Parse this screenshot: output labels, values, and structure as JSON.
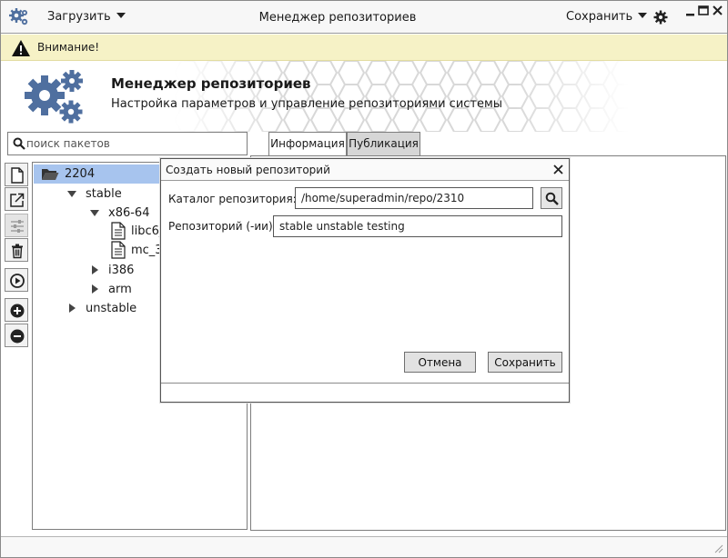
{
  "window": {
    "title": "Менеджер репозиториев",
    "menu_load": "Загрузить",
    "menu_save": "Сохранить"
  },
  "warning": {
    "text": "Внимание!"
  },
  "header": {
    "title": "Менеджер репозиториев",
    "subtitle": "Настройка параметров и управление репозиториями системы"
  },
  "search": {
    "placeholder": "поиск пакетов",
    "value": ""
  },
  "tabs": [
    {
      "label": "Информация",
      "active": true
    },
    {
      "label": "Публикация",
      "active": false
    }
  ],
  "toolbar": [
    {
      "icon": "new-file-icon",
      "enabled": true
    },
    {
      "icon": "open-external-icon",
      "enabled": true
    },
    {
      "icon": "sliders-icon",
      "enabled": false
    },
    {
      "icon": "trash-icon",
      "enabled": true
    },
    {
      "icon": "play-icon",
      "enabled": true
    },
    {
      "icon": "plus-icon",
      "enabled": true
    },
    {
      "icon": "minus-icon",
      "enabled": true
    }
  ],
  "tree": {
    "root": "2204",
    "stable": "stable",
    "x86": "x86-64",
    "file1": "libc6_",
    "file2": "mc_3",
    "i386": "i386",
    "arm": "arm",
    "unstable": "unstable"
  },
  "dialog": {
    "title": "Создать новый репозиторий",
    "dir_label": "Каталог репозитория:",
    "dir_value": "/home/superadmin/repo/2310",
    "repo_label": "Репозиторий (-ии):",
    "repo_value": "stable unstable testing",
    "cancel_label": "Отмена",
    "save_label": "Сохранить"
  },
  "colors": {
    "accent_blue": "#4f6f9f",
    "selection": "#a7c4ee",
    "warning_bg": "#f6f2c6"
  }
}
